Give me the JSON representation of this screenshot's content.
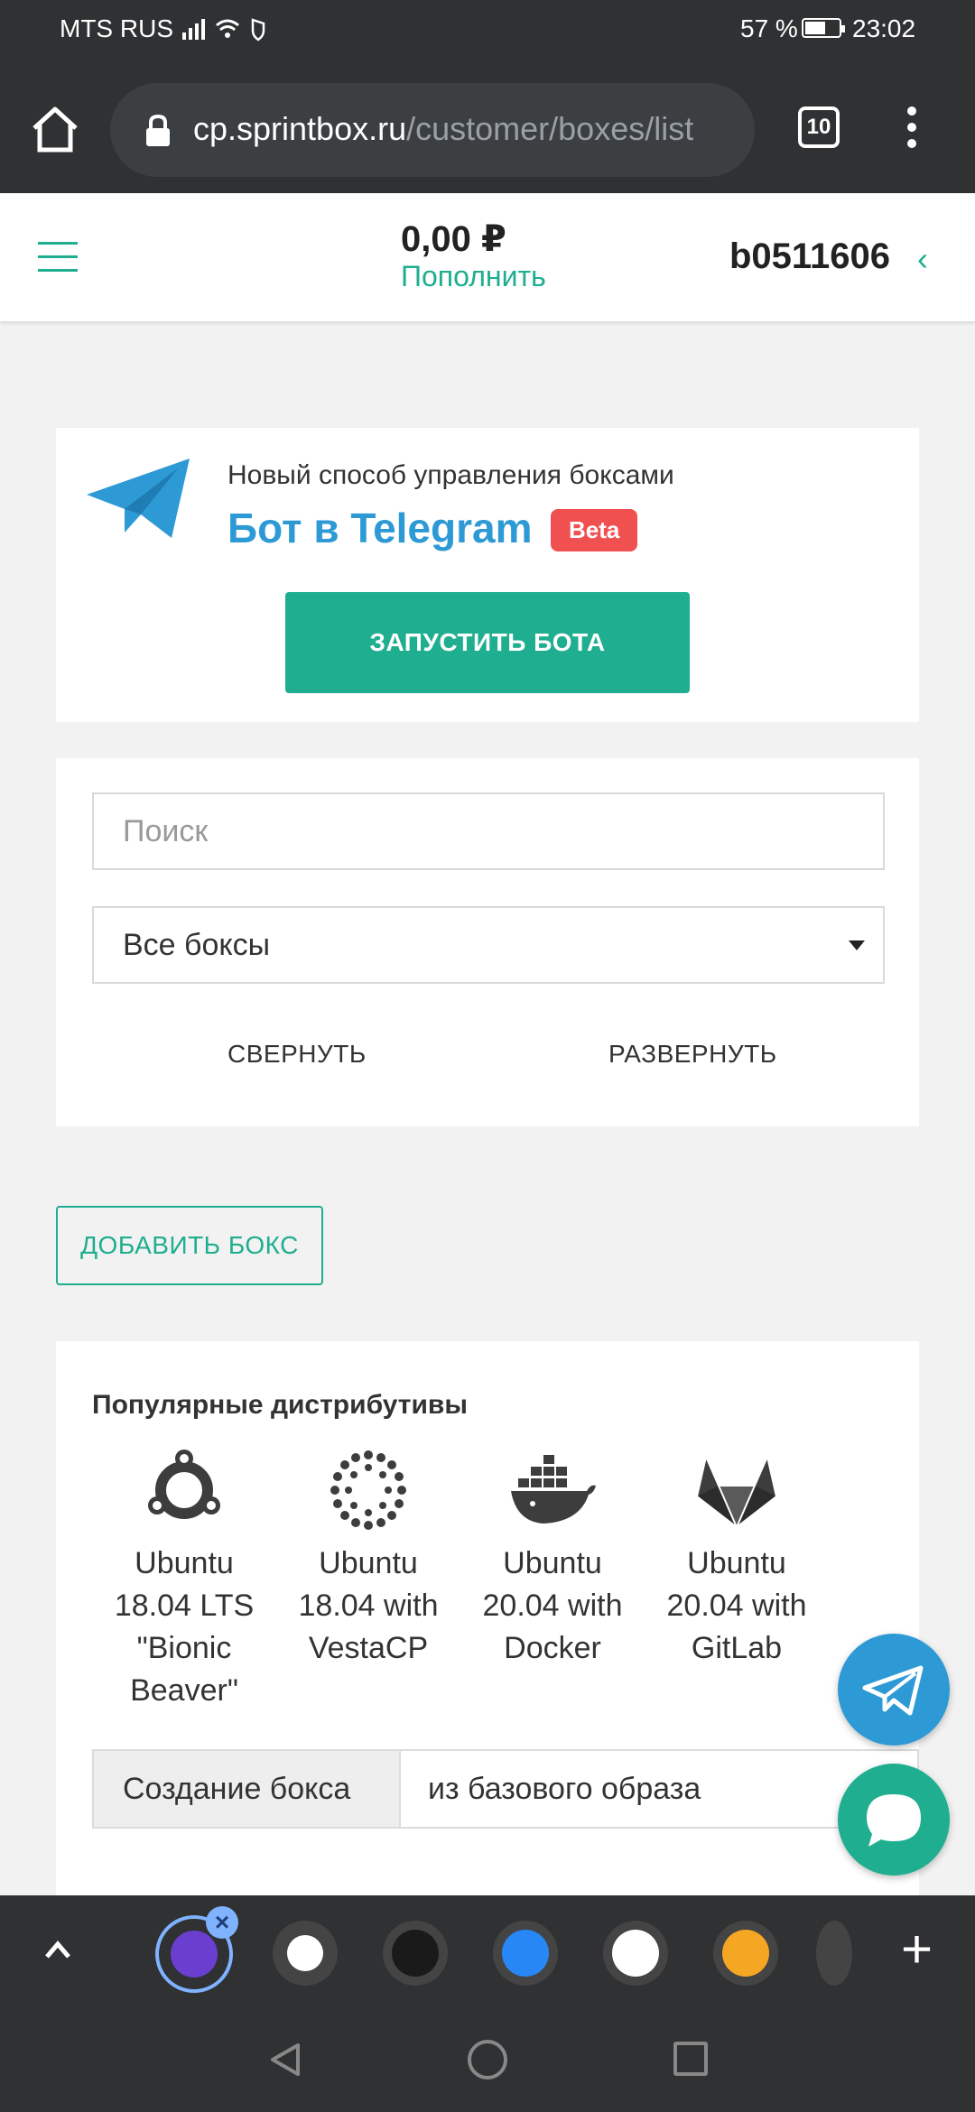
{
  "status": {
    "carrier": "MTS RUS",
    "battery": "57 %",
    "time": "23:02"
  },
  "browser": {
    "domain": "cp.sprintbox.ru",
    "path": "/customer/boxes/list",
    "tabs_count": "10"
  },
  "header": {
    "balance": "0,00 ₽",
    "topup_label": "Пополнить",
    "account_id": "b0511606",
    "account_chevron": "‹"
  },
  "telegram_card": {
    "subtitle": "Новый способ управления боксами",
    "title": "Бот в Telegram",
    "badge": "Beta",
    "button_label": "ЗАПУСТИТЬ БОТА"
  },
  "filters": {
    "search_placeholder": "Поиск",
    "select_value": "Все боксы",
    "collapse_label": "СВЕРНУТЬ",
    "expand_label": "РАЗВЕРНУТЬ"
  },
  "add_box_label": "ДОБАВИТЬ БОКС",
  "distros": {
    "heading": "Популярные дистрибутивы",
    "items": [
      {
        "name": "Ubuntu 18.04 LTS \"Bionic Beaver\"",
        "icon": "ubuntu-icon"
      },
      {
        "name": "Ubuntu 18.04 with VestaCP",
        "icon": "vestacp-icon"
      },
      {
        "name": "Ubuntu 20.04 with Docker",
        "icon": "docker-icon"
      },
      {
        "name": "Ubuntu 20.04 with GitLab",
        "icon": "gitlab-icon"
      }
    ],
    "create_label": "Создание бокса",
    "create_value": "из базового образа"
  },
  "colors": {
    "accent": "#1fae8f",
    "telegram_blue": "#2d9ad6",
    "beta_red": "#f05050",
    "chrome_dark": "#2f3133"
  }
}
